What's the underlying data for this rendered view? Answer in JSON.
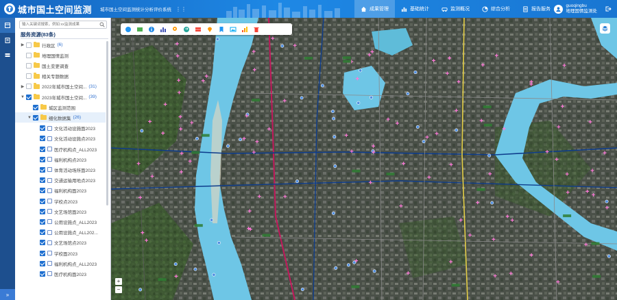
{
  "header": {
    "title": "城市国土空间监测",
    "subtitle": "城市国土空间监测统计分析评价系统"
  },
  "nav": [
    {
      "label": "成果管理",
      "icon": "home-icon",
      "active": true
    },
    {
      "label": "基础统计",
      "icon": "chart-icon",
      "active": false
    },
    {
      "label": "监测概况",
      "icon": "car-icon",
      "active": false
    },
    {
      "label": "综合分析",
      "icon": "pie-icon",
      "active": false
    },
    {
      "label": "报告服务",
      "icon": "report-icon",
      "active": false
    }
  ],
  "user": {
    "name": "guoqingbu",
    "org": "地理国情监测处"
  },
  "panel": {
    "search_placeholder": "输入关键词搜索，例如:xx监测成果",
    "resource_title": "服务资源(83条)"
  },
  "tree": [
    {
      "level": 0,
      "caret": "▶",
      "checked": false,
      "type": "folder",
      "label": "行政区",
      "count": "(6)"
    },
    {
      "level": 0,
      "caret": "",
      "checked": false,
      "type": "folder",
      "label": "地理国情监测",
      "count": ""
    },
    {
      "level": 0,
      "caret": "",
      "checked": false,
      "type": "folder",
      "label": "国土变更调查",
      "count": ""
    },
    {
      "level": 0,
      "caret": "",
      "checked": false,
      "type": "folder",
      "label": "相关专题数据",
      "count": ""
    },
    {
      "level": 0,
      "caret": "▶",
      "checked": false,
      "type": "folder",
      "label": "2022年城市国土空间...",
      "count": "(31)"
    },
    {
      "level": 0,
      "caret": "▼",
      "checked": true,
      "type": "folder",
      "label": "2023年城市国土空间...",
      "count": "(39)"
    },
    {
      "level": 1,
      "caret": "",
      "checked": true,
      "type": "folder",
      "label": "城区监测范围",
      "count": ""
    },
    {
      "level": 1,
      "caret": "▼",
      "checked": true,
      "type": "folder",
      "label": "细化数据集",
      "count": "(26)",
      "selected": true
    },
    {
      "level": 2,
      "caret": "",
      "checked": true,
      "type": "layer",
      "label": "文化活动设施面2023",
      "count": ""
    },
    {
      "level": 2,
      "caret": "",
      "checked": true,
      "type": "layer",
      "label": "文化活动设施点2023",
      "count": ""
    },
    {
      "level": 2,
      "caret": "",
      "checked": true,
      "type": "layer",
      "label": "医疗机构点_ALL2023",
      "count": ""
    },
    {
      "level": 2,
      "caret": "",
      "checked": true,
      "type": "layer",
      "label": "福利机构点2023",
      "count": ""
    },
    {
      "level": 2,
      "caret": "",
      "checked": true,
      "type": "layer",
      "label": "体育活动场所面2023",
      "count": ""
    },
    {
      "level": 2,
      "caret": "",
      "checked": true,
      "type": "layer",
      "label": "交通运输用地点2023",
      "count": ""
    },
    {
      "level": 2,
      "caret": "",
      "checked": true,
      "type": "layer",
      "label": "福利机构面2023",
      "count": ""
    },
    {
      "level": 2,
      "caret": "",
      "checked": true,
      "type": "layer",
      "label": "学校点2023",
      "count": ""
    },
    {
      "level": 2,
      "caret": "",
      "checked": true,
      "type": "layer",
      "label": "文艺场馆面2023",
      "count": ""
    },
    {
      "level": 2,
      "caret": "",
      "checked": true,
      "type": "layer",
      "label": "公用设施点_ALL2023",
      "count": ""
    },
    {
      "level": 2,
      "caret": "",
      "checked": true,
      "type": "layer",
      "label": "公用设施点_ALL202...",
      "count": ""
    },
    {
      "level": 2,
      "caret": "",
      "checked": true,
      "type": "layer",
      "label": "文艺场馆点2023",
      "count": ""
    },
    {
      "level": 2,
      "caret": "",
      "checked": true,
      "type": "layer",
      "label": "学校面2023",
      "count": ""
    },
    {
      "level": 2,
      "caret": "",
      "checked": true,
      "type": "layer",
      "label": "福利机构点_ALL2023",
      "count": ""
    },
    {
      "level": 2,
      "caret": "",
      "checked": true,
      "type": "layer",
      "label": "医疗机构面2023",
      "count": ""
    }
  ],
  "colors": {
    "header": "#1976d2",
    "river": "#6ec6e6",
    "rail": "#1d4f8e",
    "metro_red": "#c2185b",
    "metro_blue": "#0d3c8c",
    "poi_pink": "#ff7ad9",
    "checkbox": "#1e6fd0"
  },
  "toolbar_icons": [
    "globe-icon",
    "image-icon",
    "info-icon",
    "bar-chart-icon",
    "node-icon",
    "swap-icon",
    "table-icon",
    "pin-icon",
    "bookmark-icon",
    "picture-icon",
    "chart-icon",
    "delete-icon"
  ]
}
